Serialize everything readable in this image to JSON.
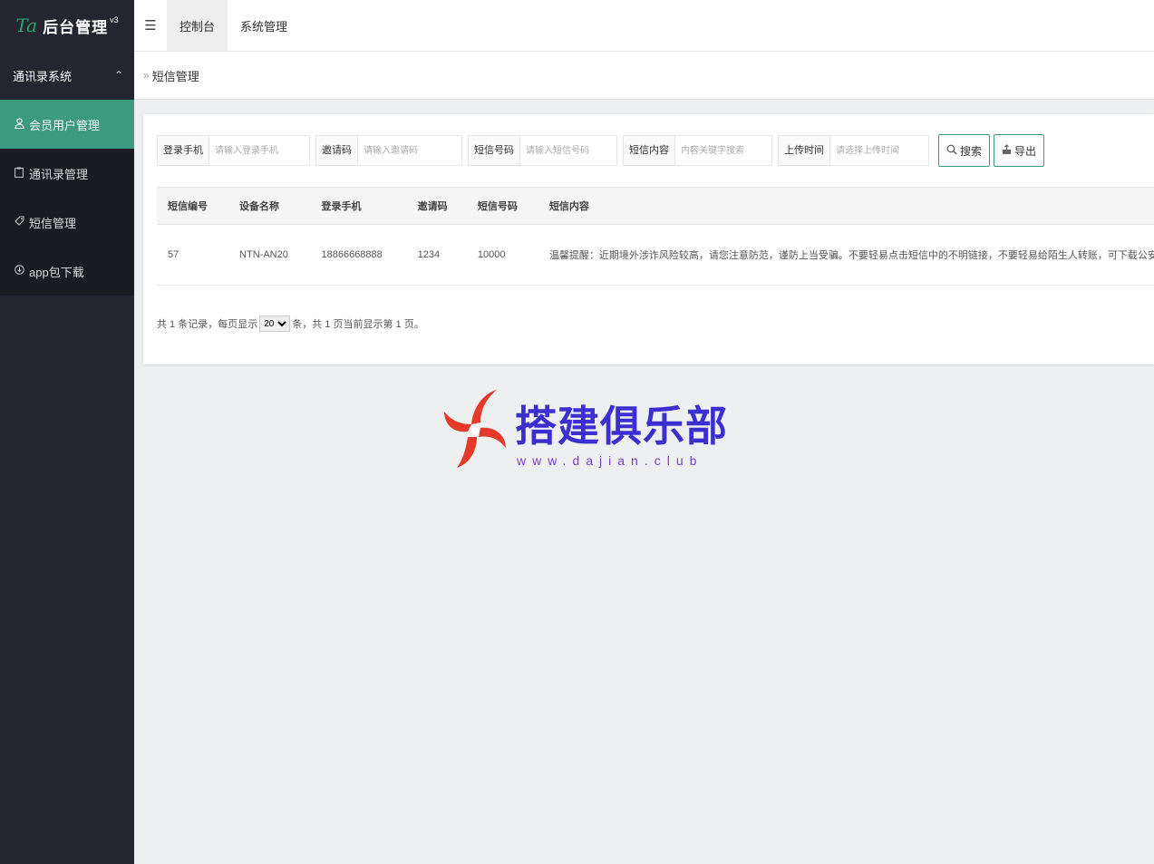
{
  "app": {
    "logo_mark": "Ta",
    "title": "后台管理",
    "version": "v3"
  },
  "sidebar": {
    "group_label": "通讯录系统",
    "group_chevron": "chevron-up-icon",
    "items": [
      {
        "label": "会员用户管理",
        "icon": "user-icon",
        "active": true
      },
      {
        "label": "通讯录管理",
        "icon": "clipboard-icon",
        "active": false
      },
      {
        "label": "短信管理",
        "icon": "tag-icon",
        "active": false
      },
      {
        "label": "app包下载",
        "icon": "download-icon",
        "active": false
      }
    ]
  },
  "topbar": {
    "toggle_icon": "menu-fold-icon",
    "tabs": [
      {
        "label": "控制台",
        "active": true
      },
      {
        "label": "系统管理",
        "active": false
      }
    ]
  },
  "breadcrumb": {
    "separator": "»",
    "current": "短信管理"
  },
  "filters": [
    {
      "label": "登录手机",
      "placeholder": "请输入登录手机"
    },
    {
      "label": "邀请码",
      "placeholder": "请输入邀请码"
    },
    {
      "label": "短信号码",
      "placeholder": "请输入短信号码"
    },
    {
      "label": "短信内容",
      "placeholder": "内容关键字搜索"
    },
    {
      "label": "上传时间",
      "placeholder": "请选择上传时间"
    }
  ],
  "buttons": {
    "search": "搜索",
    "export": "导出"
  },
  "table": {
    "columns": [
      "短信编号",
      "设备名称",
      "登录手机",
      "邀请码",
      "短信号码",
      "短信内容"
    ],
    "rows": [
      [
        "57",
        "NTN-AN20",
        "18866668888",
        "1234",
        "10000",
        "温馨提醒：近期境外涉诈风险较高，请您注意防范，谨防上当受骗。不要轻易点击短信中的不明链接，不要轻易给陌生人转账，可下载公安机关的“国家反诈中心APP”提高风险防范与识别能力。【中国电"
      ]
    ]
  },
  "pager": {
    "prefix": "共 1 条记录，每页显示",
    "page_size": "20",
    "suffix": "条，共 1 页当前显示第 1 页。"
  },
  "watermark": {
    "brand": "搭建俱乐部",
    "url": "www.dajian.club"
  },
  "colors": {
    "sidebar_bg": "#23262e",
    "accent": "#3c9a7e",
    "watermark_text": "#3b2fd0",
    "watermark_logo": "#e53a2a"
  }
}
